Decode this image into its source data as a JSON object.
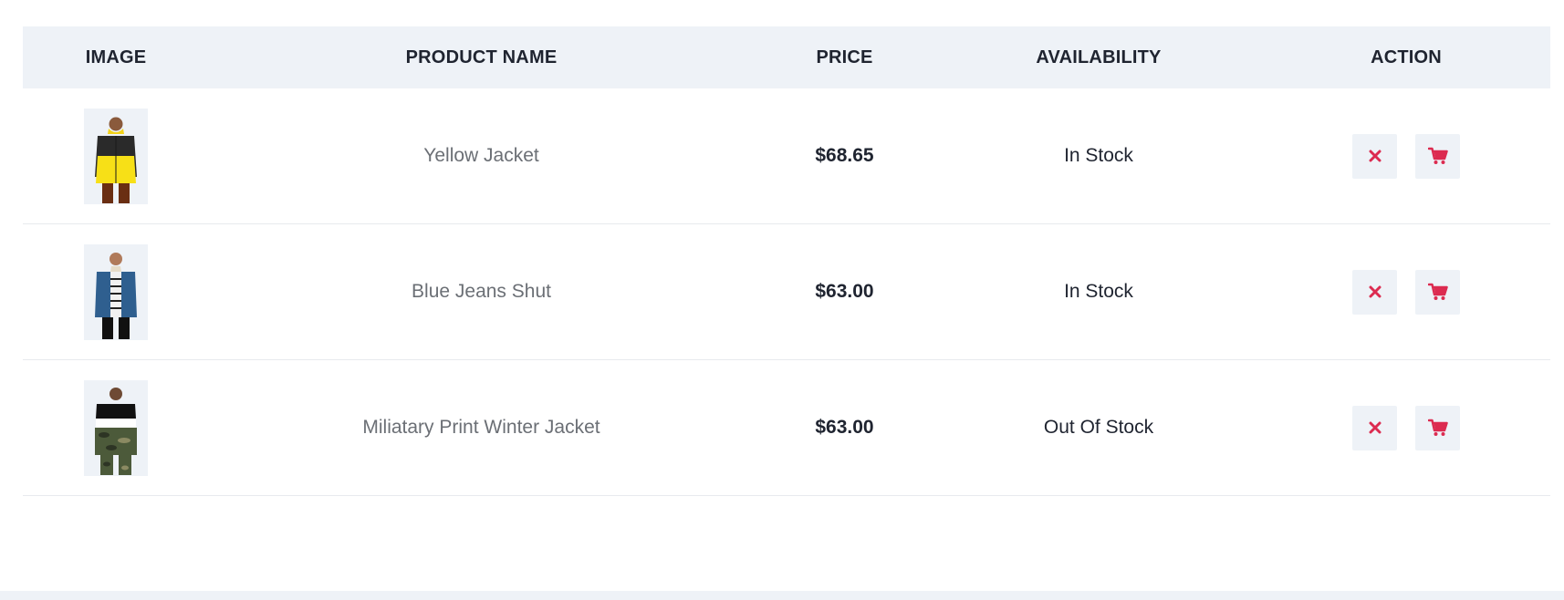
{
  "table": {
    "headers": {
      "image": "IMAGE",
      "product_name": "PRODUCT NAME",
      "price": "PRICE",
      "availability": "AVAILABILITY",
      "action": "ACTION"
    },
    "rows": [
      {
        "name": "Yellow Jacket",
        "price": "$68.65",
        "availability": "In Stock",
        "thumb": "yellow-black-hooded-jacket"
      },
      {
        "name": "Blue Jeans Shut",
        "price": "$63.00",
        "availability": "In Stock",
        "thumb": "denim-jacket"
      },
      {
        "name": "Miliatary Print Winter Jacket",
        "price": "$63.00",
        "availability": "Out Of Stock",
        "thumb": "camo-print-jacket"
      }
    ]
  },
  "icons": {
    "remove": "close-icon",
    "cart": "cart-icon"
  },
  "colors": {
    "accent": "#dc2b50",
    "header_bg": "#eef2f7",
    "text": "#1f2430",
    "muted_text": "#6b6f75"
  }
}
